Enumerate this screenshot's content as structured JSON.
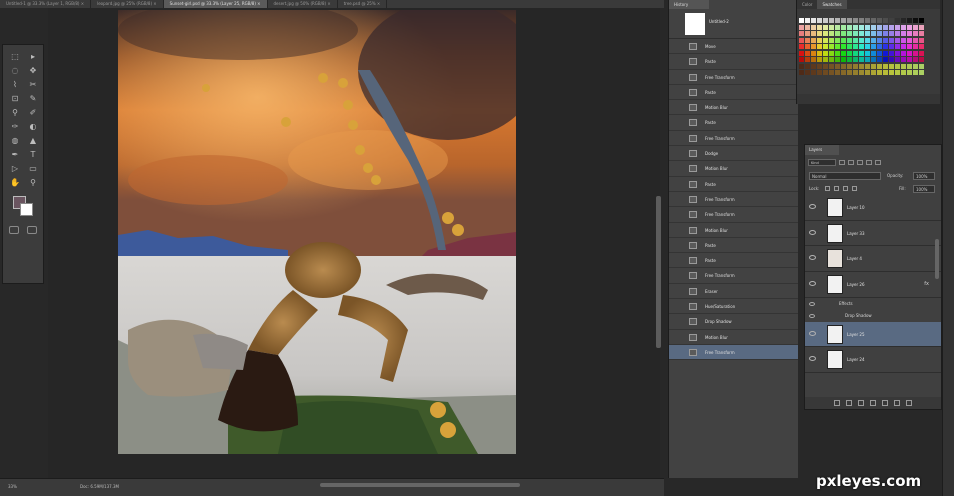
{
  "doc_tabs": [
    {
      "label": "Untitled-1 @ 33.3% (Layer 1, RGB/8) ×"
    },
    {
      "label": "leopard.jpg @ 25% (RGB/8) ×"
    },
    {
      "label": "Sunset-girl.psd @ 33.3% (Layer 25, RGB/8) ×",
      "active": true
    },
    {
      "label": "desert.jpg @ 50% (RGB/8) ×"
    },
    {
      "label": "tree.psd @ 25% ×"
    }
  ],
  "tools": [
    "⬚",
    "▸",
    "◌",
    "✥",
    "⌇",
    "✂",
    "⊡",
    "✎",
    "⚲",
    "✐",
    "✑",
    "◐",
    "◍",
    "▲",
    "✒",
    "T",
    "▷",
    "▭",
    "✋",
    "⚲"
  ],
  "history": {
    "panel_title": "History",
    "snapshot_label": "Untitled-2",
    "steps": [
      "Move",
      "Paste",
      "Free Transform",
      "Paste",
      "Motion Blur",
      "Paste",
      "Free Transform",
      "Dodge",
      "Motion Blur",
      "Paste",
      "Free Transform",
      "Free Transform",
      "Motion Blur",
      "Paste",
      "Paste",
      "Free Transform",
      "Eraser",
      "Hue/Saturation",
      "Drop Shadow",
      "Motion Blur",
      "Free Transform"
    ],
    "selected_index": 20
  },
  "swatches_panel": {
    "tabs": [
      "Color",
      "Swatches"
    ],
    "active_tab": 1
  },
  "layers": {
    "panel_title": "Layers",
    "filter_kind": "Kind",
    "blend_mode": "Normal",
    "opacity_label": "Opacity:",
    "opacity_value": "100%",
    "lock_label": "Lock:",
    "fill_label": "Fill:",
    "fill_value": "100%",
    "rows": [
      {
        "name": "Layer 10"
      },
      {
        "name": "Layer 33"
      },
      {
        "name": "Layer 4"
      },
      {
        "name": "Layer 26",
        "fx": "fx"
      }
    ],
    "effects_label": "Effects",
    "drop_shadow_label": "Drop Shadow",
    "rows_after": [
      {
        "name": "Layer 25",
        "selected": true
      },
      {
        "name": "Layer 24"
      }
    ]
  },
  "status": {
    "zoom": "33%",
    "doc_size": "Doc: 6.59M/137.3M"
  },
  "watermark": "pxleyes.com"
}
